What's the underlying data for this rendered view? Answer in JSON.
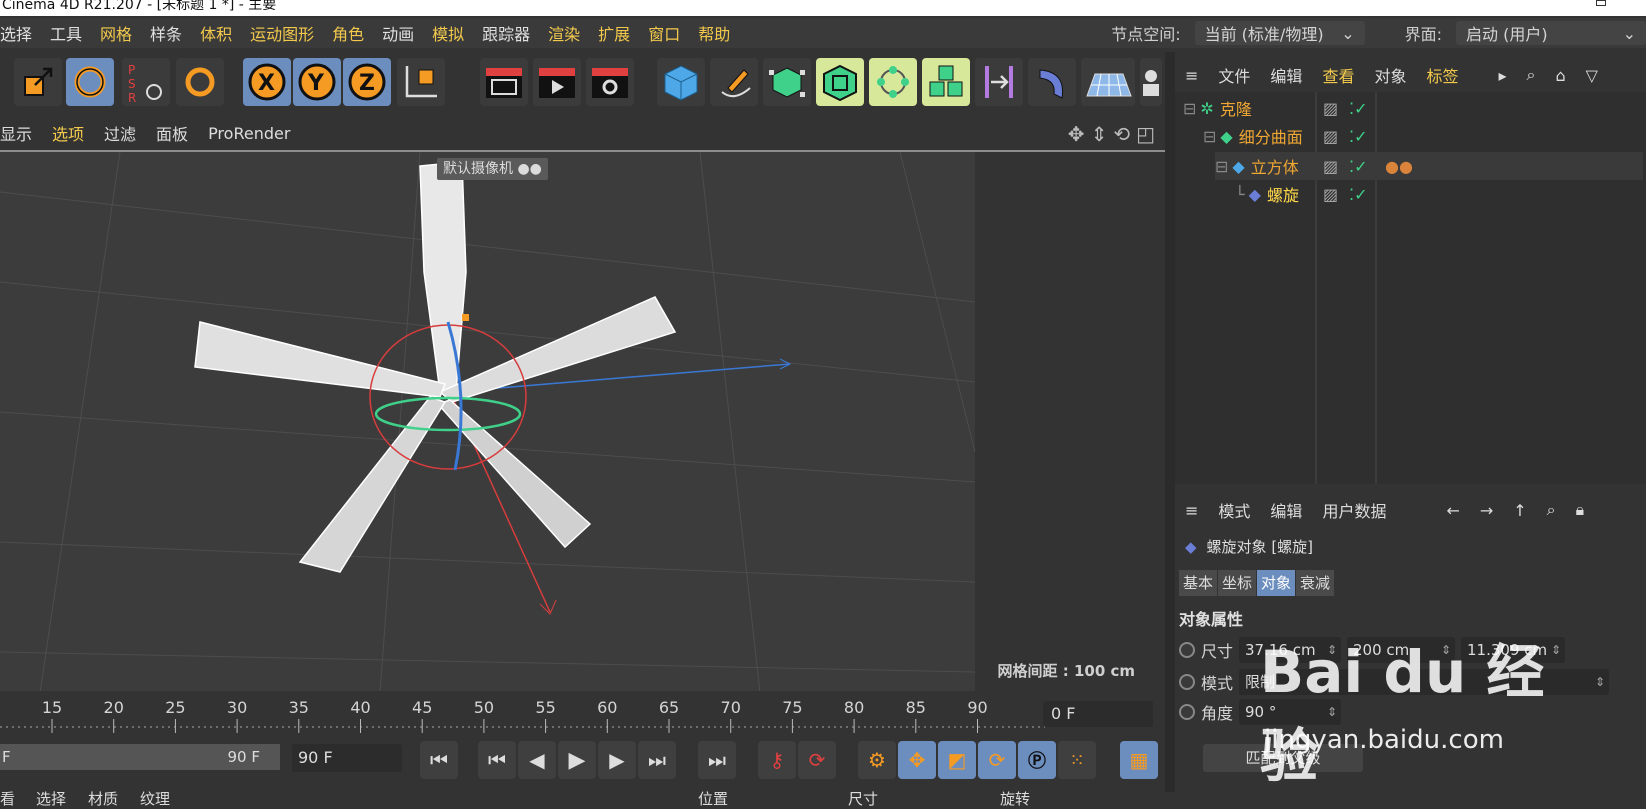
{
  "window": {
    "title": "Cinema 4D R21.207 - [未标题 1 *] - 主要"
  },
  "menubar": {
    "items": [
      "选择",
      "工具",
      "网格",
      "样条",
      "体积",
      "运动图形",
      "角色",
      "动画",
      "模拟",
      "跟踪器",
      "渲染",
      "扩展",
      "窗口",
      "帮助"
    ],
    "node_space_label": "节点空间:",
    "node_space_value": "当前 (标准/物理)",
    "layout_label": "界面:",
    "layout_value": "启动 (用户)"
  },
  "viewport_menu": {
    "items": [
      "显示",
      "选项",
      "过滤",
      "面板",
      "ProRender"
    ]
  },
  "viewport": {
    "camera_label": "默认摄像机 ●●",
    "grid_spacing": "网格间距 : 100 cm"
  },
  "timeline": {
    "ticks": [
      "15",
      "20",
      "25",
      "30",
      "35",
      "40",
      "45",
      "50",
      "55",
      "60",
      "65",
      "70",
      "75",
      "80",
      "85",
      "90"
    ],
    "current_frame": "0 F",
    "range_start": "F",
    "range_end": "90 F",
    "max_frame": "90 F"
  },
  "bottom_tabs": {
    "left": [
      "看",
      "选择",
      "材质",
      "纹理"
    ],
    "right": [
      "位置",
      "尺寸",
      "旋转"
    ]
  },
  "object_manager": {
    "menu": [
      "文件",
      "编辑",
      "查看",
      "对象",
      "标签"
    ],
    "objects": [
      {
        "name": "克隆"
      },
      {
        "name": "细分曲面"
      },
      {
        "name": "立方体"
      },
      {
        "name": "螺旋"
      }
    ]
  },
  "attribute_manager": {
    "menu": [
      "模式",
      "编辑",
      "用户数据"
    ],
    "object_title": "螺旋对象 [螺旋]",
    "tabs": [
      "基本",
      "坐标",
      "对象",
      "衰减"
    ],
    "active_tab": "对象",
    "section": "对象属性",
    "size_label": "尺寸",
    "size_x": "37.16 cm",
    "size_y": "200 cm",
    "size_z": "11.309 cm",
    "mode_label": "模式",
    "mode_value": "限制",
    "angle_label": "角度",
    "angle_value": "90 °",
    "match_button": "匹配到父级"
  },
  "watermark": {
    "logo": "Bai du 经验",
    "url": "jingyan.baidu.com"
  },
  "colors": {
    "accent_yellow": "#f2c94c",
    "selected_blue": "#6c8ebf",
    "object_orange": "#f0a733"
  }
}
